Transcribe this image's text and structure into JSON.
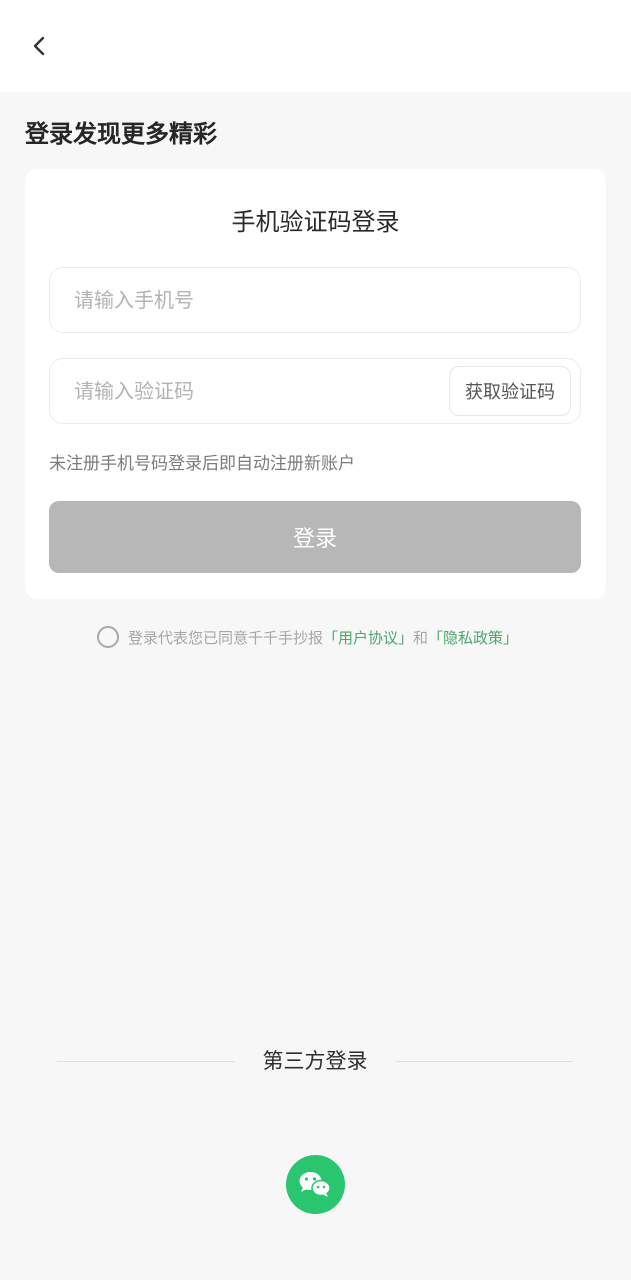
{
  "header": {
    "back_icon": "chevron-left-icon"
  },
  "page_title": "登录发现更多精彩",
  "card": {
    "title": "手机验证码登录",
    "phone_placeholder": "请输入手机号",
    "code_placeholder": "请输入验证码",
    "get_code_label": "获取验证码",
    "hint": "未注册手机号码登录后即自动注册新账户",
    "login_label": "登录"
  },
  "agreement": {
    "checked": false,
    "prefix": "登录代表您已同意千千手抄报",
    "user_agreement": "「用户协议」",
    "and": "和",
    "privacy_policy": "「隐私政策」"
  },
  "third_party": {
    "label": "第三方登录",
    "wechat_icon": "wechat-icon"
  },
  "colors": {
    "accent_green": "#2ac56f",
    "link_green": "#4aa86b",
    "disabled_button": "#b7b7b7",
    "background": "#f6f7f6"
  }
}
